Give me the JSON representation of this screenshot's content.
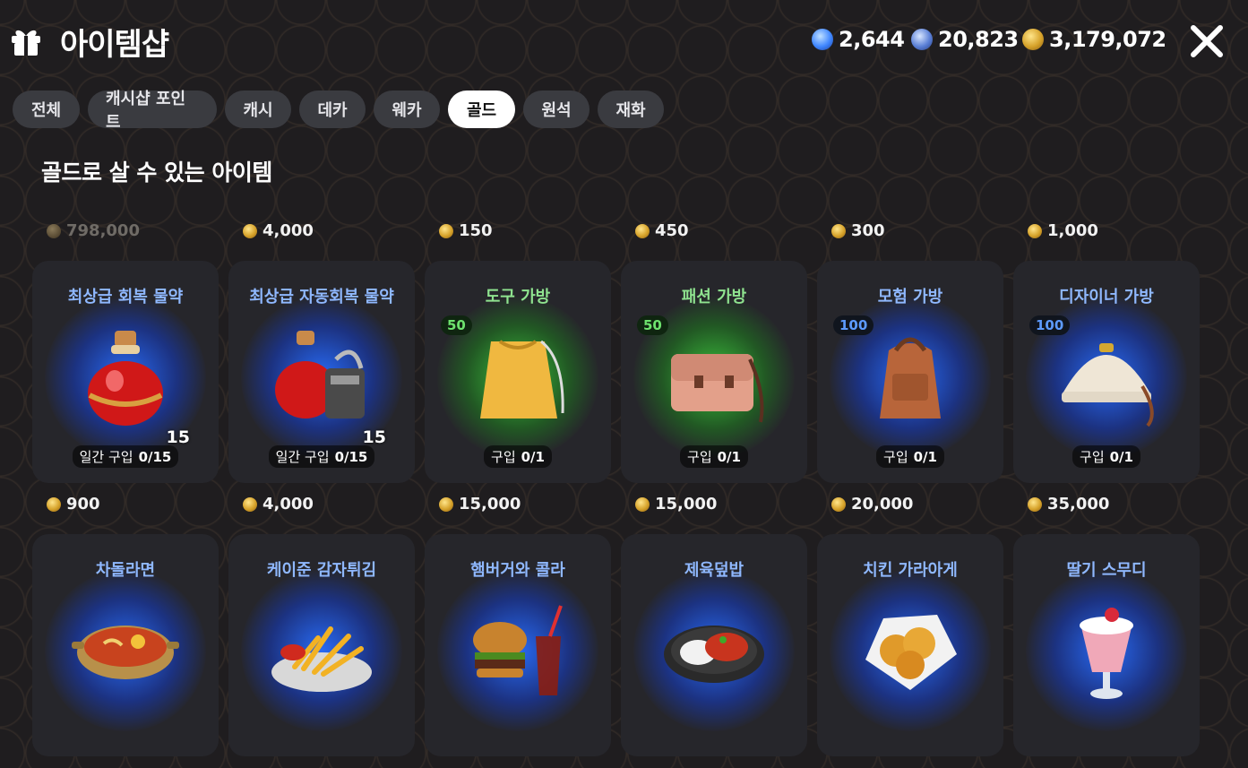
{
  "header": {
    "title": "아이템샵",
    "currencies": [
      {
        "icon": "blue-gem-icon",
        "value": "2,644",
        "color": "#4a8dff"
      },
      {
        "icon": "silver-coin-icon",
        "value": "20,823",
        "color": "#6b8fdc"
      },
      {
        "icon": "gold-coin-icon",
        "value": "3,179,072",
        "color": "#e0aa2c"
      }
    ]
  },
  "tabs": [
    {
      "label": "전체",
      "active": false
    },
    {
      "label": "캐시샵 포인트",
      "active": false
    },
    {
      "label": "캐시",
      "active": false
    },
    {
      "label": "데카",
      "active": false
    },
    {
      "label": "웨카",
      "active": false
    },
    {
      "label": "골드",
      "active": true
    },
    {
      "label": "원석",
      "active": false
    },
    {
      "label": "재화",
      "active": false
    }
  ],
  "section_title": "골드로 살 수 있는 아이템",
  "items": [
    {
      "price": "798,000",
      "name": "최상급 회복 물약",
      "glow": "blue",
      "icon": "red-potion-icon",
      "limit_label": "일간 구입",
      "limit_value": "0/15",
      "qty": "15",
      "disabled": true
    },
    {
      "price": "4,000",
      "name": "최상급 자동회복 물약",
      "glow": "blue",
      "icon": "auto-potion-icon",
      "limit_label": "일간 구입",
      "limit_value": "0/15",
      "qty": "15",
      "disabled": false
    },
    {
      "price": "150",
      "name": "도구 가방",
      "glow": "green",
      "icon": "drawstring-bag-icon",
      "badge": "50",
      "limit_label": "구입",
      "limit_value": "0/1",
      "disabled": false
    },
    {
      "price": "450",
      "name": "패션 가방",
      "glow": "green",
      "icon": "satchel-bag-icon",
      "badge": "50",
      "limit_label": "구입",
      "limit_value": "0/1",
      "disabled": false
    },
    {
      "price": "300",
      "name": "모험 가방",
      "glow": "blue",
      "icon": "backpack-icon",
      "badge": "100",
      "limit_label": "구입",
      "limit_value": "0/1",
      "disabled": false
    },
    {
      "price": "1,000",
      "name": "디자이너 가방",
      "glow": "blue",
      "icon": "designer-bag-icon",
      "badge": "100",
      "limit_label": "구입",
      "limit_value": "0/1",
      "disabled": false
    },
    {
      "price": "900",
      "name": "차돌라면",
      "glow": "blue",
      "icon": "ramen-bowl-icon",
      "disabled": false
    },
    {
      "price": "4,000",
      "name": "케이준 감자튀김",
      "glow": "blue",
      "icon": "fries-icon",
      "disabled": false
    },
    {
      "price": "15,000",
      "name": "햄버거와 콜라",
      "glow": "blue",
      "icon": "burger-cola-icon",
      "disabled": false
    },
    {
      "price": "15,000",
      "name": "제육덮밥",
      "glow": "blue",
      "icon": "rice-bowl-icon",
      "disabled": false
    },
    {
      "price": "20,000",
      "name": "치킨 가라아게",
      "glow": "blue",
      "icon": "fried-chicken-icon",
      "disabled": false
    },
    {
      "price": "35,000",
      "name": "딸기 스무디",
      "glow": "blue",
      "icon": "strawberry-smoothie-icon",
      "disabled": false
    }
  ]
}
